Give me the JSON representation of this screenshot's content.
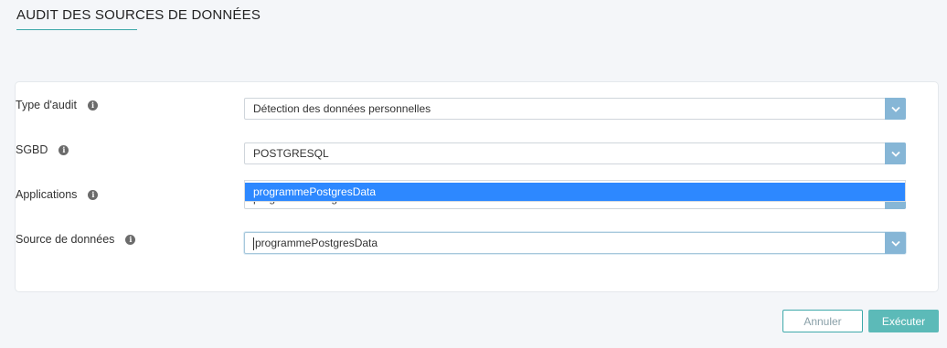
{
  "page": {
    "title": "AUDIT DES SOURCES DE DONNÉES"
  },
  "form": {
    "fields": [
      {
        "label": "Type d'audit",
        "value": "Détection des données personnelles"
      },
      {
        "label": "SGBD",
        "value": "POSTGRESQL"
      },
      {
        "label": "Applications",
        "value": "programmePostgresData"
      },
      {
        "label": "Source de données",
        "value": "programmePostgresData"
      }
    ],
    "dropdown": {
      "options": [
        "programmePostgresData"
      ]
    }
  },
  "actions": {
    "cancel_label": "Annuler",
    "run_label": "Exécuter"
  },
  "colors": {
    "accent": "#3aa7a8",
    "toggle": "#86b6d6",
    "highlight": "#2d88ff",
    "run_button": "#5cbab8"
  },
  "icons": {
    "info": "info-icon",
    "toggle": "chevron-down-icon"
  }
}
